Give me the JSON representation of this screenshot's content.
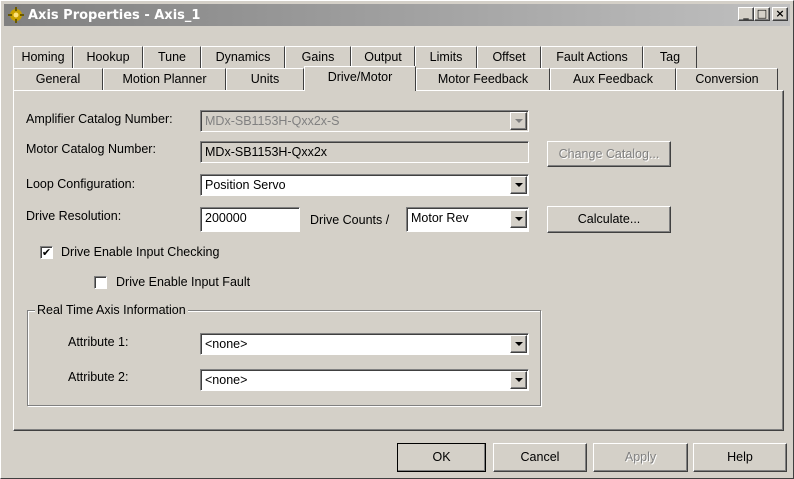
{
  "window": {
    "title": "Axis Properties - Axis_1"
  },
  "title_buttons": {
    "minimize": "_",
    "maximize": "□",
    "close": "×"
  },
  "tabs_row1": [
    "Homing",
    "Hookup",
    "Tune",
    "Dynamics",
    "Gains",
    "Output",
    "Limits",
    "Offset",
    "Fault Actions",
    "Tag"
  ],
  "tabs_row2": [
    "General",
    "Motion Planner",
    "Units",
    "Drive/Motor",
    "Motor Feedback",
    "Aux Feedback",
    "Conversion"
  ],
  "active_tab": "Drive/Motor",
  "form": {
    "amplifier_label": "Amplifier Catalog Number:",
    "amplifier_value": "MDx-SB1153H-Qxx2x-S",
    "motor_label": "Motor Catalog Number:",
    "motor_value": "MDx-SB1153H-Qxx2x",
    "change_catalog_label": "Change Catalog...",
    "loop_label": "Loop Configuration:",
    "loop_value": "Position Servo",
    "resolution_label": "Drive Resolution:",
    "resolution_value": "200000",
    "drive_counts_label": "Drive Counts /",
    "resolution_unit": "Motor Rev",
    "calculate_label": "Calculate...",
    "enable_checking_label": "Drive Enable Input Checking",
    "enable_checking_checked": true,
    "enable_fault_label": "Drive Enable Input Fault",
    "enable_fault_checked": false,
    "group_title": "Real Time Axis Information",
    "attr1_label": "Attribute 1:",
    "attr1_value": "<none>",
    "attr2_label": "Attribute 2:",
    "attr2_value": "<none>"
  },
  "footer": {
    "ok": "OK",
    "cancel": "Cancel",
    "apply": "Apply",
    "help": "Help"
  },
  "check_glyph": "✔"
}
